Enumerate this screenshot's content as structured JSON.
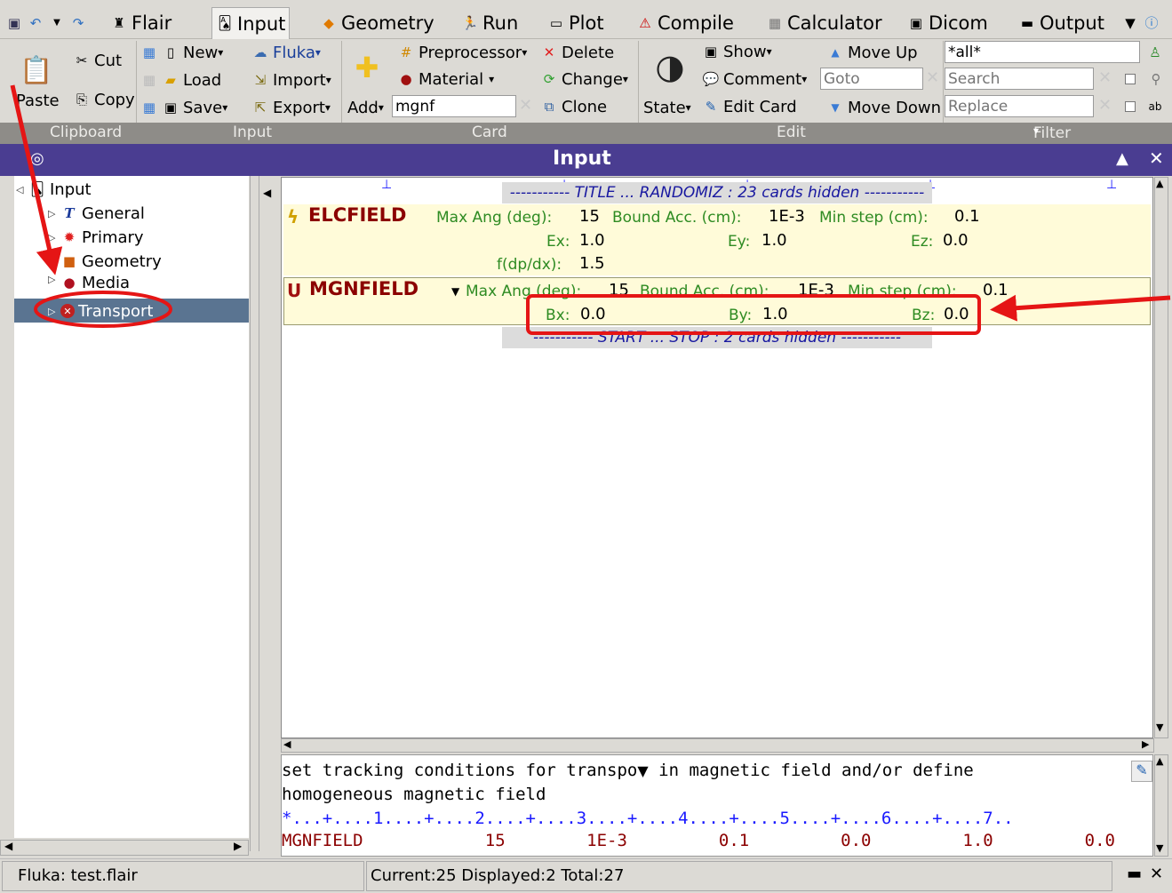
{
  "tabbar": {
    "flair": "Flair",
    "input": "Input",
    "geometry": "Geometry",
    "run": "Run",
    "plot": "Plot",
    "compile": "Compile",
    "calculator": "Calculator",
    "dicom": "Dicom",
    "output": "Output"
  },
  "ribbon": {
    "cut": "Cut",
    "copy": "Copy",
    "paste": "Paste",
    "new": "New",
    "load": "Load",
    "save": "Save",
    "fluka": "Fluka",
    "import": "Import",
    "export": "Export",
    "preprocessor": "Preprocessor",
    "material": "Material",
    "add": "Add",
    "add_value": "mgnf",
    "delete": "Delete",
    "change": "Change",
    "clone": "Clone",
    "state": "State",
    "show": "Show",
    "comment": "Comment",
    "edit_card": "Edit Card",
    "goto_placeholder": "Goto",
    "move_up": "Move Up",
    "move_down": "Move Down",
    "filter_value": "*all*",
    "search_placeholder": "Search",
    "replace_placeholder": "Replace"
  },
  "groups": {
    "clipboard": "Clipboard",
    "input": "Input",
    "card": "Card",
    "edit": "Edit",
    "filter": "Filter"
  },
  "header": {
    "title": "Input"
  },
  "tree": {
    "root": "Input",
    "items": [
      "General",
      "Primary",
      "Geometry",
      "Media",
      "Transport"
    ]
  },
  "editor": {
    "hidden_top": "----------- TITLE ... RANDOMIZ : 23 cards hidden -----------",
    "hidden_bottom": "----------- START ... STOP : 2 cards hidden -----------",
    "elc": {
      "name": "ELCFIELD",
      "maxang_label": "Max Ang (deg):",
      "maxang": "15",
      "bound_label": "Bound Acc. (cm):",
      "bound": "1E-3",
      "minstep_label": "Min step (cm):",
      "minstep": "0.1",
      "ex_label": "Ex:",
      "ex": "1.0",
      "ey_label": "Ey:",
      "ey": "1.0",
      "ez_label": "Ez:",
      "ez": "0.0",
      "fdp_label": "f(dp/dx):",
      "fdp": "1.5"
    },
    "mgn": {
      "name": "MGNFIELD",
      "maxang_label": "Max Ang (deg):",
      "maxang": "15",
      "bound_label": "Bound Acc. (cm):",
      "bound": "1E-3",
      "minstep_label": "Min step (cm):",
      "minstep": "0.1",
      "bx_label": "Bx:",
      "bx": "0.0",
      "by_label": "By:",
      "by": "1.0",
      "bz_label": "Bz:",
      "bz": "0.0"
    }
  },
  "desc": {
    "line1a": "set tracking conditions for transpo",
    "line1b": "in magnetic field and/or define",
    "line2": "homogeneous magnetic field",
    "ruler": "*...+....1....+....2....+....3....+....4....+....5....+....6....+....7..",
    "card": "MGNFIELD            15        1E-3         0.1         0.0         1.0         0.0"
  },
  "status": {
    "file": "Fluka: test.flair",
    "counts": "Current:25  Displayed:2 Total:27"
  },
  "colors": {
    "header": "#4a3d91",
    "selection": "#5a7491",
    "annotation": "#e51515",
    "card_bg": "#fffbd9"
  }
}
